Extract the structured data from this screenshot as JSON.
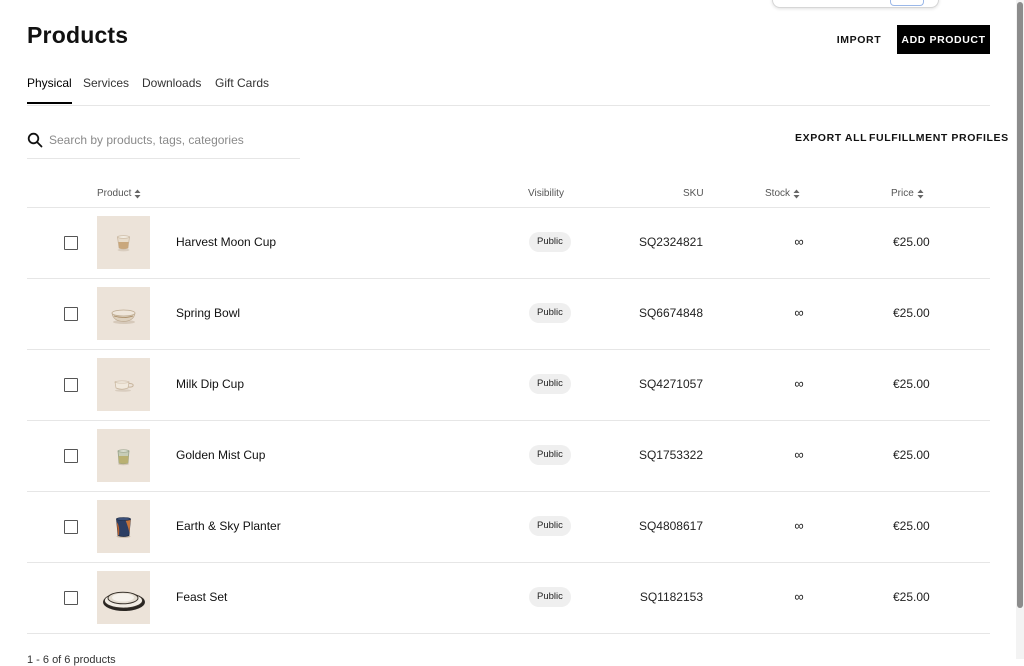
{
  "header": {
    "title": "Products",
    "import_label": "IMPORT",
    "add_product_label": "ADD PRODUCT"
  },
  "tabs": [
    {
      "label": "Physical",
      "active": true
    },
    {
      "label": "Services",
      "active": false
    },
    {
      "label": "Downloads",
      "active": false
    },
    {
      "label": "Gift Cards",
      "active": false
    }
  ],
  "toolbar": {
    "search_placeholder": "Search by products, tags, categories",
    "search_value": "",
    "search_icon": "search-icon",
    "export_all_label": "EXPORT ALL",
    "fulfillment_profiles_label": "FULFILLMENT PROFILES"
  },
  "table": {
    "columns": {
      "product": "Product",
      "visibility": "Visibility",
      "sku": "SKU",
      "stock": "Stock",
      "price": "Price"
    },
    "rows": [
      {
        "name": "Harvest Moon Cup",
        "visibility": "Public",
        "sku": "SQ2324821",
        "stock": "∞",
        "price": "€25.00",
        "thumb_icon": "cup-icon"
      },
      {
        "name": "Spring Bowl",
        "visibility": "Public",
        "sku": "SQ6674848",
        "stock": "∞",
        "price": "€25.00",
        "thumb_icon": "bowl-icon"
      },
      {
        "name": "Milk Dip Cup",
        "visibility": "Public",
        "sku": "SQ4271057",
        "stock": "∞",
        "price": "€25.00",
        "thumb_icon": "handle-cup-icon"
      },
      {
        "name": "Golden Mist Cup",
        "visibility": "Public",
        "sku": "SQ1753322",
        "stock": "∞",
        "price": "€25.00",
        "thumb_icon": "tumbler-icon"
      },
      {
        "name": "Earth & Sky Planter",
        "visibility": "Public",
        "sku": "SQ4808617",
        "stock": "∞",
        "price": "€25.00",
        "thumb_icon": "planter-icon"
      },
      {
        "name": "Feast Set",
        "visibility": "Public",
        "sku": "SQ1182153",
        "stock": "∞",
        "price": "€25.00",
        "thumb_icon": "plates-icon"
      }
    ]
  },
  "pagination": {
    "label": "1 - 6 of 6 products"
  },
  "colors": {
    "primary_button": "#000000",
    "thumbnail_background": "#ece3d9",
    "badge_background": "#efefef",
    "divider": "#e6e6e6"
  }
}
